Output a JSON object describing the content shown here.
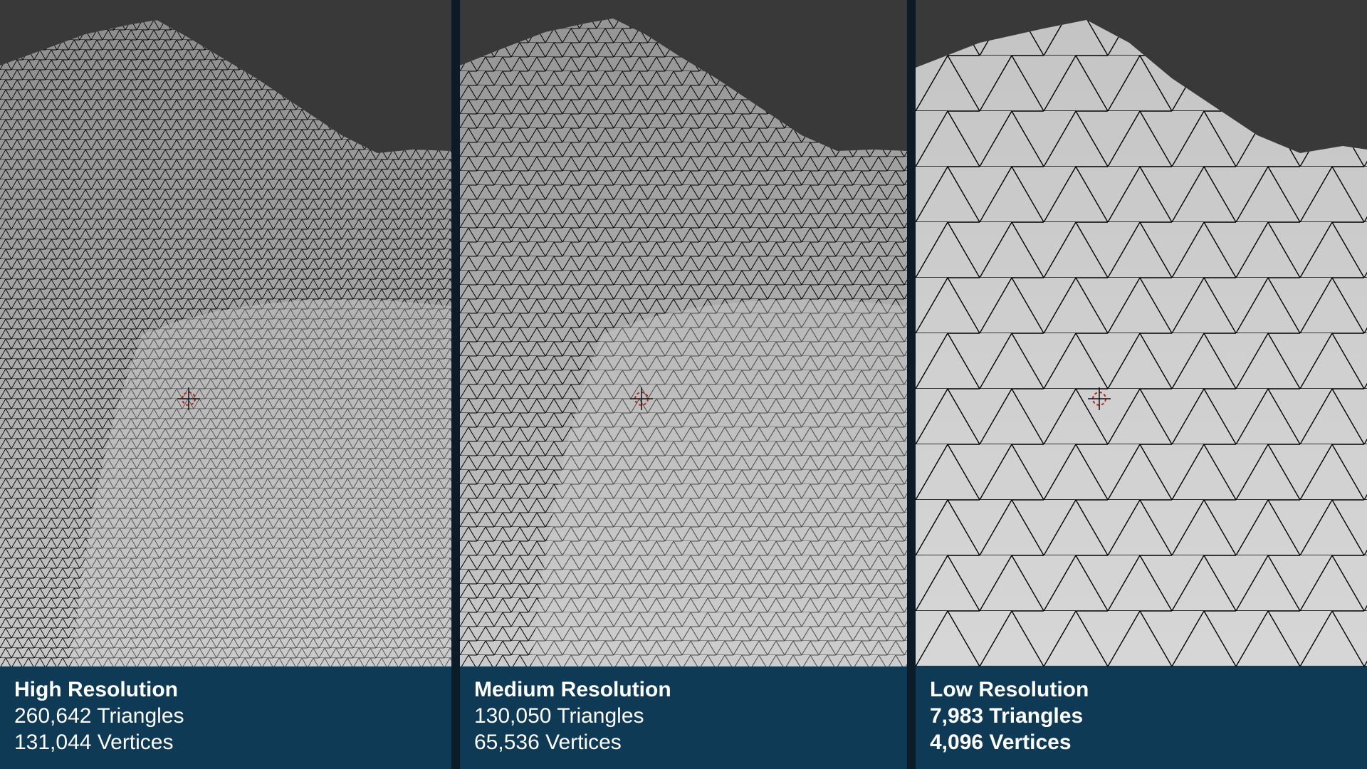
{
  "colors": {
    "sky": "#393939",
    "terrain_light": "#c9c9c9",
    "terrain_dark": "#8f8f8f",
    "wire": "#000000",
    "caption_bg": "#0f3a55",
    "divider": "#0b1c26",
    "caption_text": "#ffffff"
  },
  "panels": [
    {
      "title": "High Resolution",
      "triangles": "260,642 Triangles",
      "vertices": "131,044 Vertices",
      "stats_bold": false,
      "mesh_density": "high",
      "cursor_icon": "3d-cursor-icon"
    },
    {
      "title": "Medium Resolution",
      "triangles": "130,050 Triangles",
      "vertices": "65,536 Vertices",
      "stats_bold": false,
      "mesh_density": "medium",
      "cursor_icon": "3d-cursor-icon"
    },
    {
      "title": "Low Resolution",
      "triangles": "7,983 Triangles",
      "vertices": "4,096 Vertices",
      "stats_bold": true,
      "mesh_density": "low",
      "cursor_icon": "3d-cursor-icon"
    }
  ]
}
